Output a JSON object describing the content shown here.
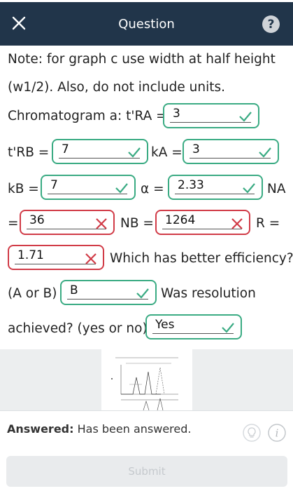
{
  "header": {
    "title": "Question",
    "close_icon": "close-icon",
    "help_icon": "help-icon",
    "help_glyph": "?"
  },
  "question": {
    "note_line1": "Note: for graph c use width at half height",
    "note_line2": "(w1/2). Also, do not include units.",
    "label_chromatogram_a": "Chromatogram a: t'RA =",
    "label_trb": "t'RB =",
    "label_ka": "kA =",
    "label_kb": "kB =",
    "label_alpha": "α =",
    "label_na": "NA",
    "label_equals": "=",
    "label_nb": "NB =",
    "label_r": "R =",
    "label_efficiency": "Which has better efficiency?",
    "label_aorb": "(A or B)",
    "label_resolution": "Was resolution",
    "label_achieved": "achieved? (yes or no)"
  },
  "answers": {
    "tra": "3",
    "trb": "7",
    "ka": "3",
    "kb": "7",
    "alpha": "2.33",
    "na": "36",
    "nb": "1264",
    "r": "1.71",
    "efficiency": "B",
    "resolution": "Yes"
  },
  "footer": {
    "answered_label": "Answered:",
    "answered_text": "Has been answered.",
    "submit_label": "Submit"
  },
  "colors": {
    "header_bg": "#21354a",
    "correct": "#3aab83",
    "incorrect": "#d13b47"
  }
}
